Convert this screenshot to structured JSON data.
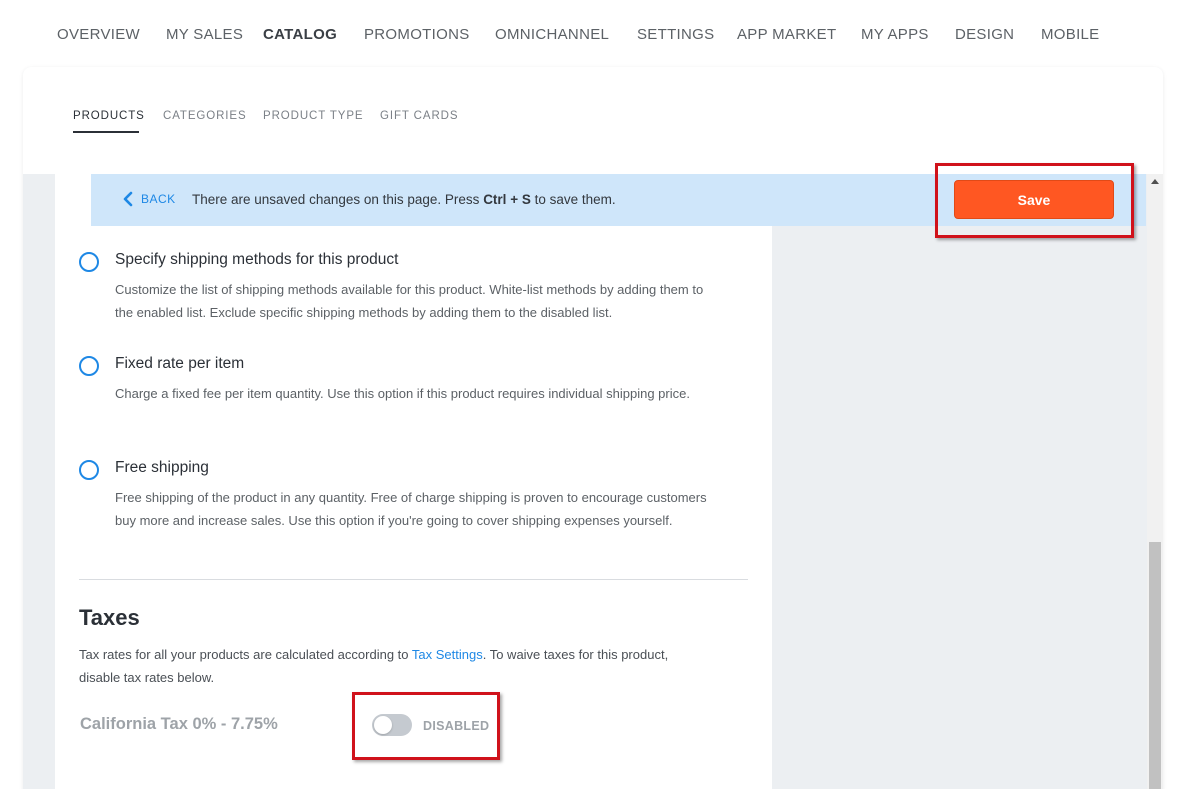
{
  "top_nav": {
    "items": [
      "OVERVIEW",
      "MY SALES",
      "CATALOG",
      "PROMOTIONS",
      "OMNICHANNEL",
      "SETTINGS",
      "APP MARKET",
      "MY APPS",
      "DESIGN",
      "MOBILE"
    ],
    "active": "CATALOG"
  },
  "sub_nav": {
    "tabs": [
      "PRODUCTS",
      "CATEGORIES",
      "PRODUCT TYPE",
      "GIFT CARDS"
    ],
    "active": "PRODUCTS"
  },
  "banner": {
    "back_label": "BACK",
    "message_prefix": "There are unsaved changes on this page. Press ",
    "key_ctrl": "Ctrl",
    "plus": " + ",
    "key_s": "S",
    "message_suffix": " to save them.",
    "save_label": "Save"
  },
  "shipping_options": [
    {
      "title": "Specify shipping methods for this product",
      "description": "Customize the list of shipping methods available for this product. White-list methods by adding them to the enabled list. Exclude specific shipping methods by adding them to the disabled list."
    },
    {
      "title": "Fixed rate per item",
      "description": "Charge a fixed fee per item quantity. Use this option if this product requires individual shipping price."
    },
    {
      "title": "Free shipping",
      "description": "Free shipping of the product in any quantity. Free of charge shipping is proven to encourage customers buy more and increase sales. Use this option if you're going to cover shipping expenses yourself."
    }
  ],
  "taxes": {
    "heading": "Taxes",
    "desc_prefix": "Tax rates for all your products are calculated according to ",
    "link_text": "Tax Settings",
    "desc_suffix": ". To waive taxes for this product, disable tax rates below.",
    "rate_name": "California Tax 0% - 7.75%",
    "toggle_state": "DISABLED",
    "toggle_on": false
  },
  "colors": {
    "accent": "#1e88e5",
    "save_button": "#ff5722",
    "banner_bg": "#cfe6fa",
    "highlight": "#d0121b"
  }
}
